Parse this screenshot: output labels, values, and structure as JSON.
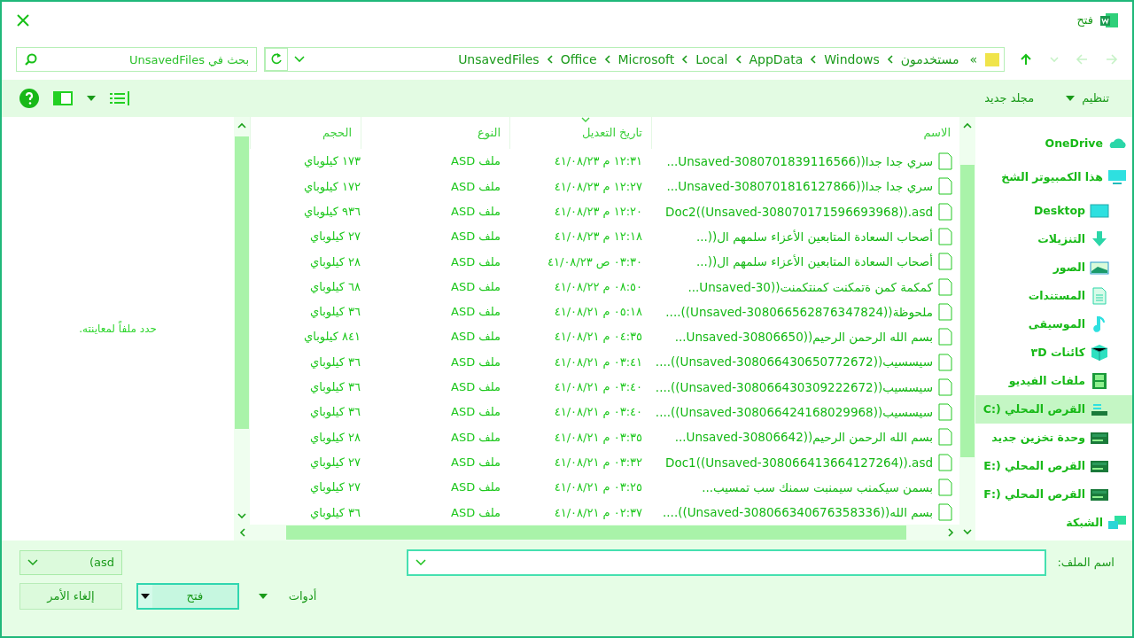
{
  "window": {
    "title": "فتح"
  },
  "nav_buttons": [
    {
      "kind": "back",
      "disabled": true
    },
    {
      "kind": "forward",
      "disabled": true
    },
    {
      "kind": "recent",
      "disabled": true
    },
    {
      "kind": "up",
      "disabled": false
    }
  ],
  "address": {
    "overflow": "»",
    "path": [
      "مستخدمون",
      "Windows",
      "AppData",
      "Local",
      "Microsoft",
      "Office",
      "UnsavedFiles"
    ]
  },
  "search": {
    "placeholder": "بحث في UnsavedFiles"
  },
  "toolbar": {
    "organize": "تنظيم",
    "new_folder": "مجلد جديد"
  },
  "sidebar": {
    "items": [
      {
        "label": "OneDrive",
        "kind": "cloud",
        "selected": false
      },
      {
        "label": "هذا الكمبيوتر الشخ",
        "kind": "pc",
        "selected": false,
        "children": [
          {
            "label": "Desktop",
            "kind": "desktop",
            "selected": false
          },
          {
            "label": "التنزيلات",
            "kind": "downloads",
            "selected": false
          },
          {
            "label": "الصور",
            "kind": "pictures",
            "selected": false
          },
          {
            "label": "المستندات",
            "kind": "documents",
            "selected": false
          },
          {
            "label": "الموسيقى",
            "kind": "music",
            "selected": false
          },
          {
            "label": "كائنات ٣D",
            "kind": "objects",
            "selected": false
          },
          {
            "label": "ملفات الفيديو",
            "kind": "videos",
            "selected": false
          },
          {
            "label": "القرص المحلي (:C",
            "kind": "system-drive",
            "selected": true
          },
          {
            "label": "وحدة تخزين جديد",
            "kind": "drive",
            "selected": false
          },
          {
            "label": "القرص المحلي (:E",
            "kind": "drive",
            "selected": false
          },
          {
            "label": "القرص المحلي (:F",
            "kind": "drive",
            "selected": false
          }
        ]
      },
      {
        "label": "الشبكة",
        "kind": "network",
        "selected": false
      }
    ]
  },
  "table": {
    "columns": [
      {
        "label": "الاسم",
        "sorted": false
      },
      {
        "label": "تاريخ التعديل",
        "sorted": true
      },
      {
        "label": "النوع",
        "sorted": false
      },
      {
        "label": "الحجم",
        "sorted": false
      }
    ],
    "rows": [
      {
        "name": "سري جدا جدا((Unsaved-3080701839116566...",
        "modified": "١٢:٣١ م ٤١/٠٨/٢٣",
        "type": "ملف ASD",
        "size": "١٧٣ كيلوباي"
      },
      {
        "name": "سري جدا جدا((Unsaved-3080701816127866...",
        "modified": "١٢:٢٧ م ٤١/٠٨/٢٣",
        "type": "ملف ASD",
        "size": "١٧٢ كيلوباي"
      },
      {
        "name": "Doc2((Unsaved-308070171596693968)).asd",
        "modified": "١٢:٢٠ م ٤١/٠٨/٢٣",
        "type": "ملف ASD",
        "size": "٩٣٦ كيلوباي"
      },
      {
        "name": "أصحاب السعادة المتابعين الأعزاء سلمهم ال((...",
        "modified": "١٢:١٨ م ٤١/٠٨/٢٣",
        "type": "ملف ASD",
        "size": "٢٧ كيلوباي"
      },
      {
        "name": "أصحاب السعادة المتابعين الأعزاء سلمهم ال((...",
        "modified": "٠٣:٣٠ ص ٤١/٠٨/٢٣",
        "type": "ملف ASD",
        "size": "٢٨ كيلوباي"
      },
      {
        "name": "كمكمة كمن ةتمكنت كمنتكمنت((Unsaved-30...",
        "modified": "٠٨:٥٠ م ٤١/٠٨/٢٢",
        "type": "ملف ASD",
        "size": "٦٨ كيلوباي"
      },
      {
        "name": "ملحوظة((Unsaved-308066562876347824))....",
        "modified": "٠٥:١٨ م ٤١/٠٨/٢١",
        "type": "ملف ASD",
        "size": "٣٦ كيلوباي"
      },
      {
        "name": "بسم الله الرحمن الرحيم((Unsaved-30806650...",
        "modified": "٠٤:٣٥ م ٤١/٠٨/٢١",
        "type": "ملف ASD",
        "size": "٨٤١ كيلوباي"
      },
      {
        "name": "سيسسيب((Unsaved-308066430650772672))....",
        "modified": "٠٣:٤١ م ٤١/٠٨/٢١",
        "type": "ملف ASD",
        "size": "٣٦ كيلوباي"
      },
      {
        "name": "سيسسيب((Unsaved-308066430309222672))....",
        "modified": "٠٣:٤٠ م ٤١/٠٨/٢١",
        "type": "ملف ASD",
        "size": "٣٦ كيلوباي"
      },
      {
        "name": "سيسسيب((Unsaved-308066424168029968))....",
        "modified": "٠٣:٤٠ م ٤١/٠٨/٢١",
        "type": "ملف ASD",
        "size": "٣٦ كيلوباي"
      },
      {
        "name": "بسم الله الرحمن الرحيم((Unsaved-30806642...",
        "modified": "٠٣:٣٥ م ٤١/٠٨/٢١",
        "type": "ملف ASD",
        "size": "٢٨ كيلوباي"
      },
      {
        "name": "Doc1((Unsaved-308066413664127264)).asd",
        "modified": "٠٣:٣٢ م ٤١/٠٨/٢١",
        "type": "ملف ASD",
        "size": "٢٧ كيلوباي"
      },
      {
        "name": "بسمن سيكمنب سيمنبت سمنك سب تمسيب...",
        "modified": "٠٣:٢٥ م ٤١/٠٨/٢١",
        "type": "ملف ASD",
        "size": "٢٧ كيلوباي"
      },
      {
        "name": "بسم الله((Unsaved-308066340676358336))....",
        "modified": "٠٢:٣٧ م ٤١/٠٨/٢١",
        "type": "ملف ASD",
        "size": "٣٦ كيلوباي"
      }
    ]
  },
  "preview": {
    "message": "حدد ملفاً لمعاينته."
  },
  "footer": {
    "filename_label": "اسم الملف:",
    "file_type": "asd)",
    "tools": "أدوات",
    "open": "فتح",
    "cancel": "إلغاء الأمر"
  }
}
